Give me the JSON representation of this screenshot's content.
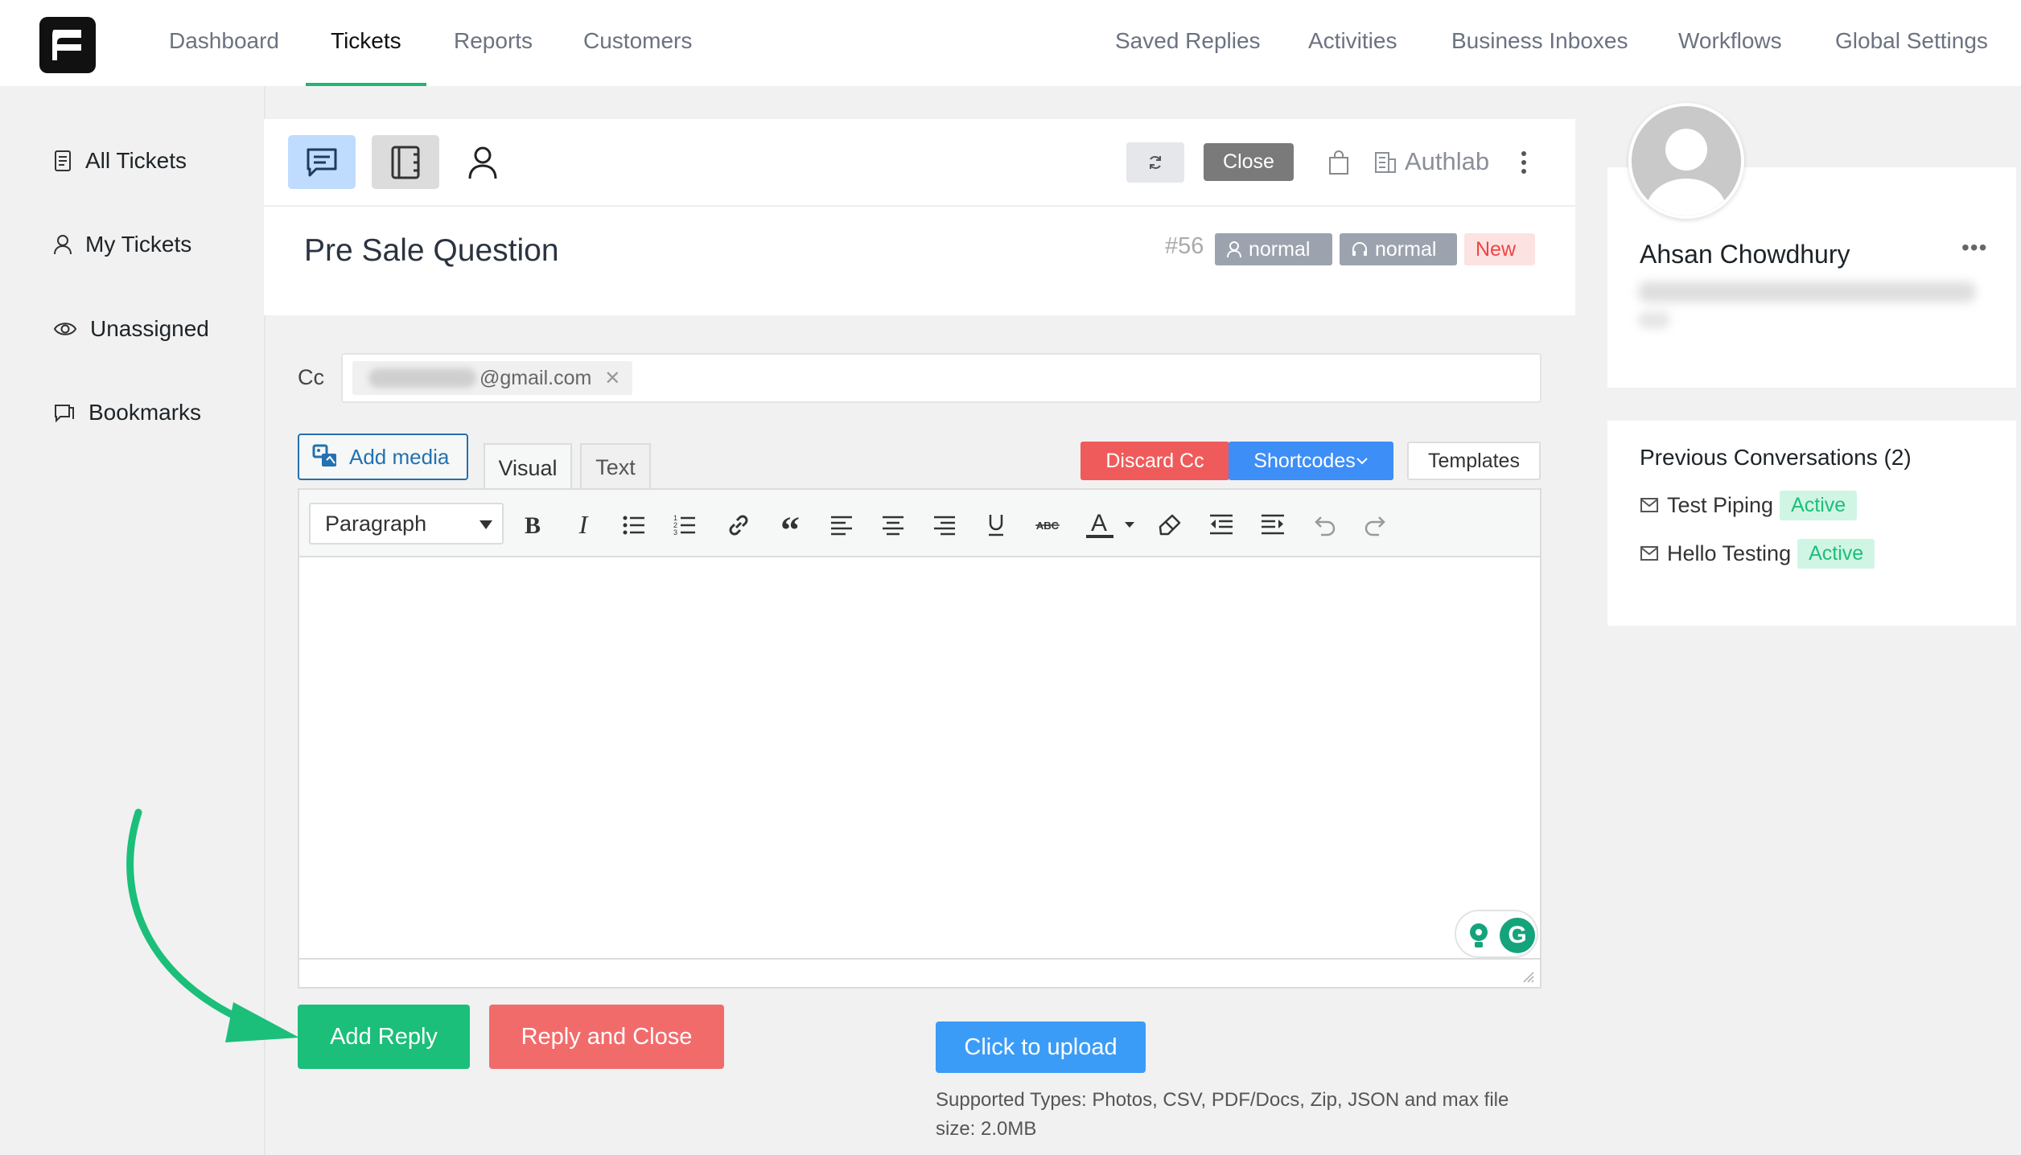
{
  "nav": {
    "left": [
      "Dashboard",
      "Tickets",
      "Reports",
      "Customers"
    ],
    "right": [
      "Saved Replies",
      "Activities",
      "Business Inboxes",
      "Workflows",
      "Global Settings"
    ],
    "active": "Tickets"
  },
  "sidebar": {
    "items": [
      {
        "label": "All Tickets",
        "icon": "document-icon"
      },
      {
        "label": "My Tickets",
        "icon": "user-icon"
      },
      {
        "label": "Unassigned",
        "icon": "eye-icon"
      },
      {
        "label": "Bookmarks",
        "icon": "bookmark-icon"
      }
    ]
  },
  "ticket": {
    "close_label": "Close",
    "mailbox": "Authlab",
    "title": "Pre Sale Question",
    "id": "#56",
    "priority_customer": "normal",
    "priority_agent": "normal",
    "status": "New"
  },
  "reply": {
    "cc_label": "Cc",
    "cc_email": "@gmail.com",
    "add_media": "Add media",
    "tab_visual": "Visual",
    "tab_text": "Text",
    "discard_cc": "Discard Cc",
    "shortcodes": "Shortcodes",
    "templates": "Templates",
    "format_select": "Paragraph",
    "add_reply": "Add Reply",
    "reply_and_close": "Reply and Close",
    "upload": "Click to upload",
    "upload_note": "Supported Types: Photos, CSV, PDF/Docs, Zip, JSON and max file size: 2.0MB"
  },
  "profile": {
    "name": "Ahsan Chowdhury",
    "more": "•••"
  },
  "previous": {
    "title": "Previous Conversations (2)",
    "items": [
      {
        "label": "Test Piping",
        "status": "Active"
      },
      {
        "label": "Hello Testing",
        "status": "Active"
      }
    ]
  },
  "colors": {
    "accent_green": "#1bbf7a",
    "danger_red": "#f26b6b",
    "primary_blue": "#3b9cf7"
  }
}
